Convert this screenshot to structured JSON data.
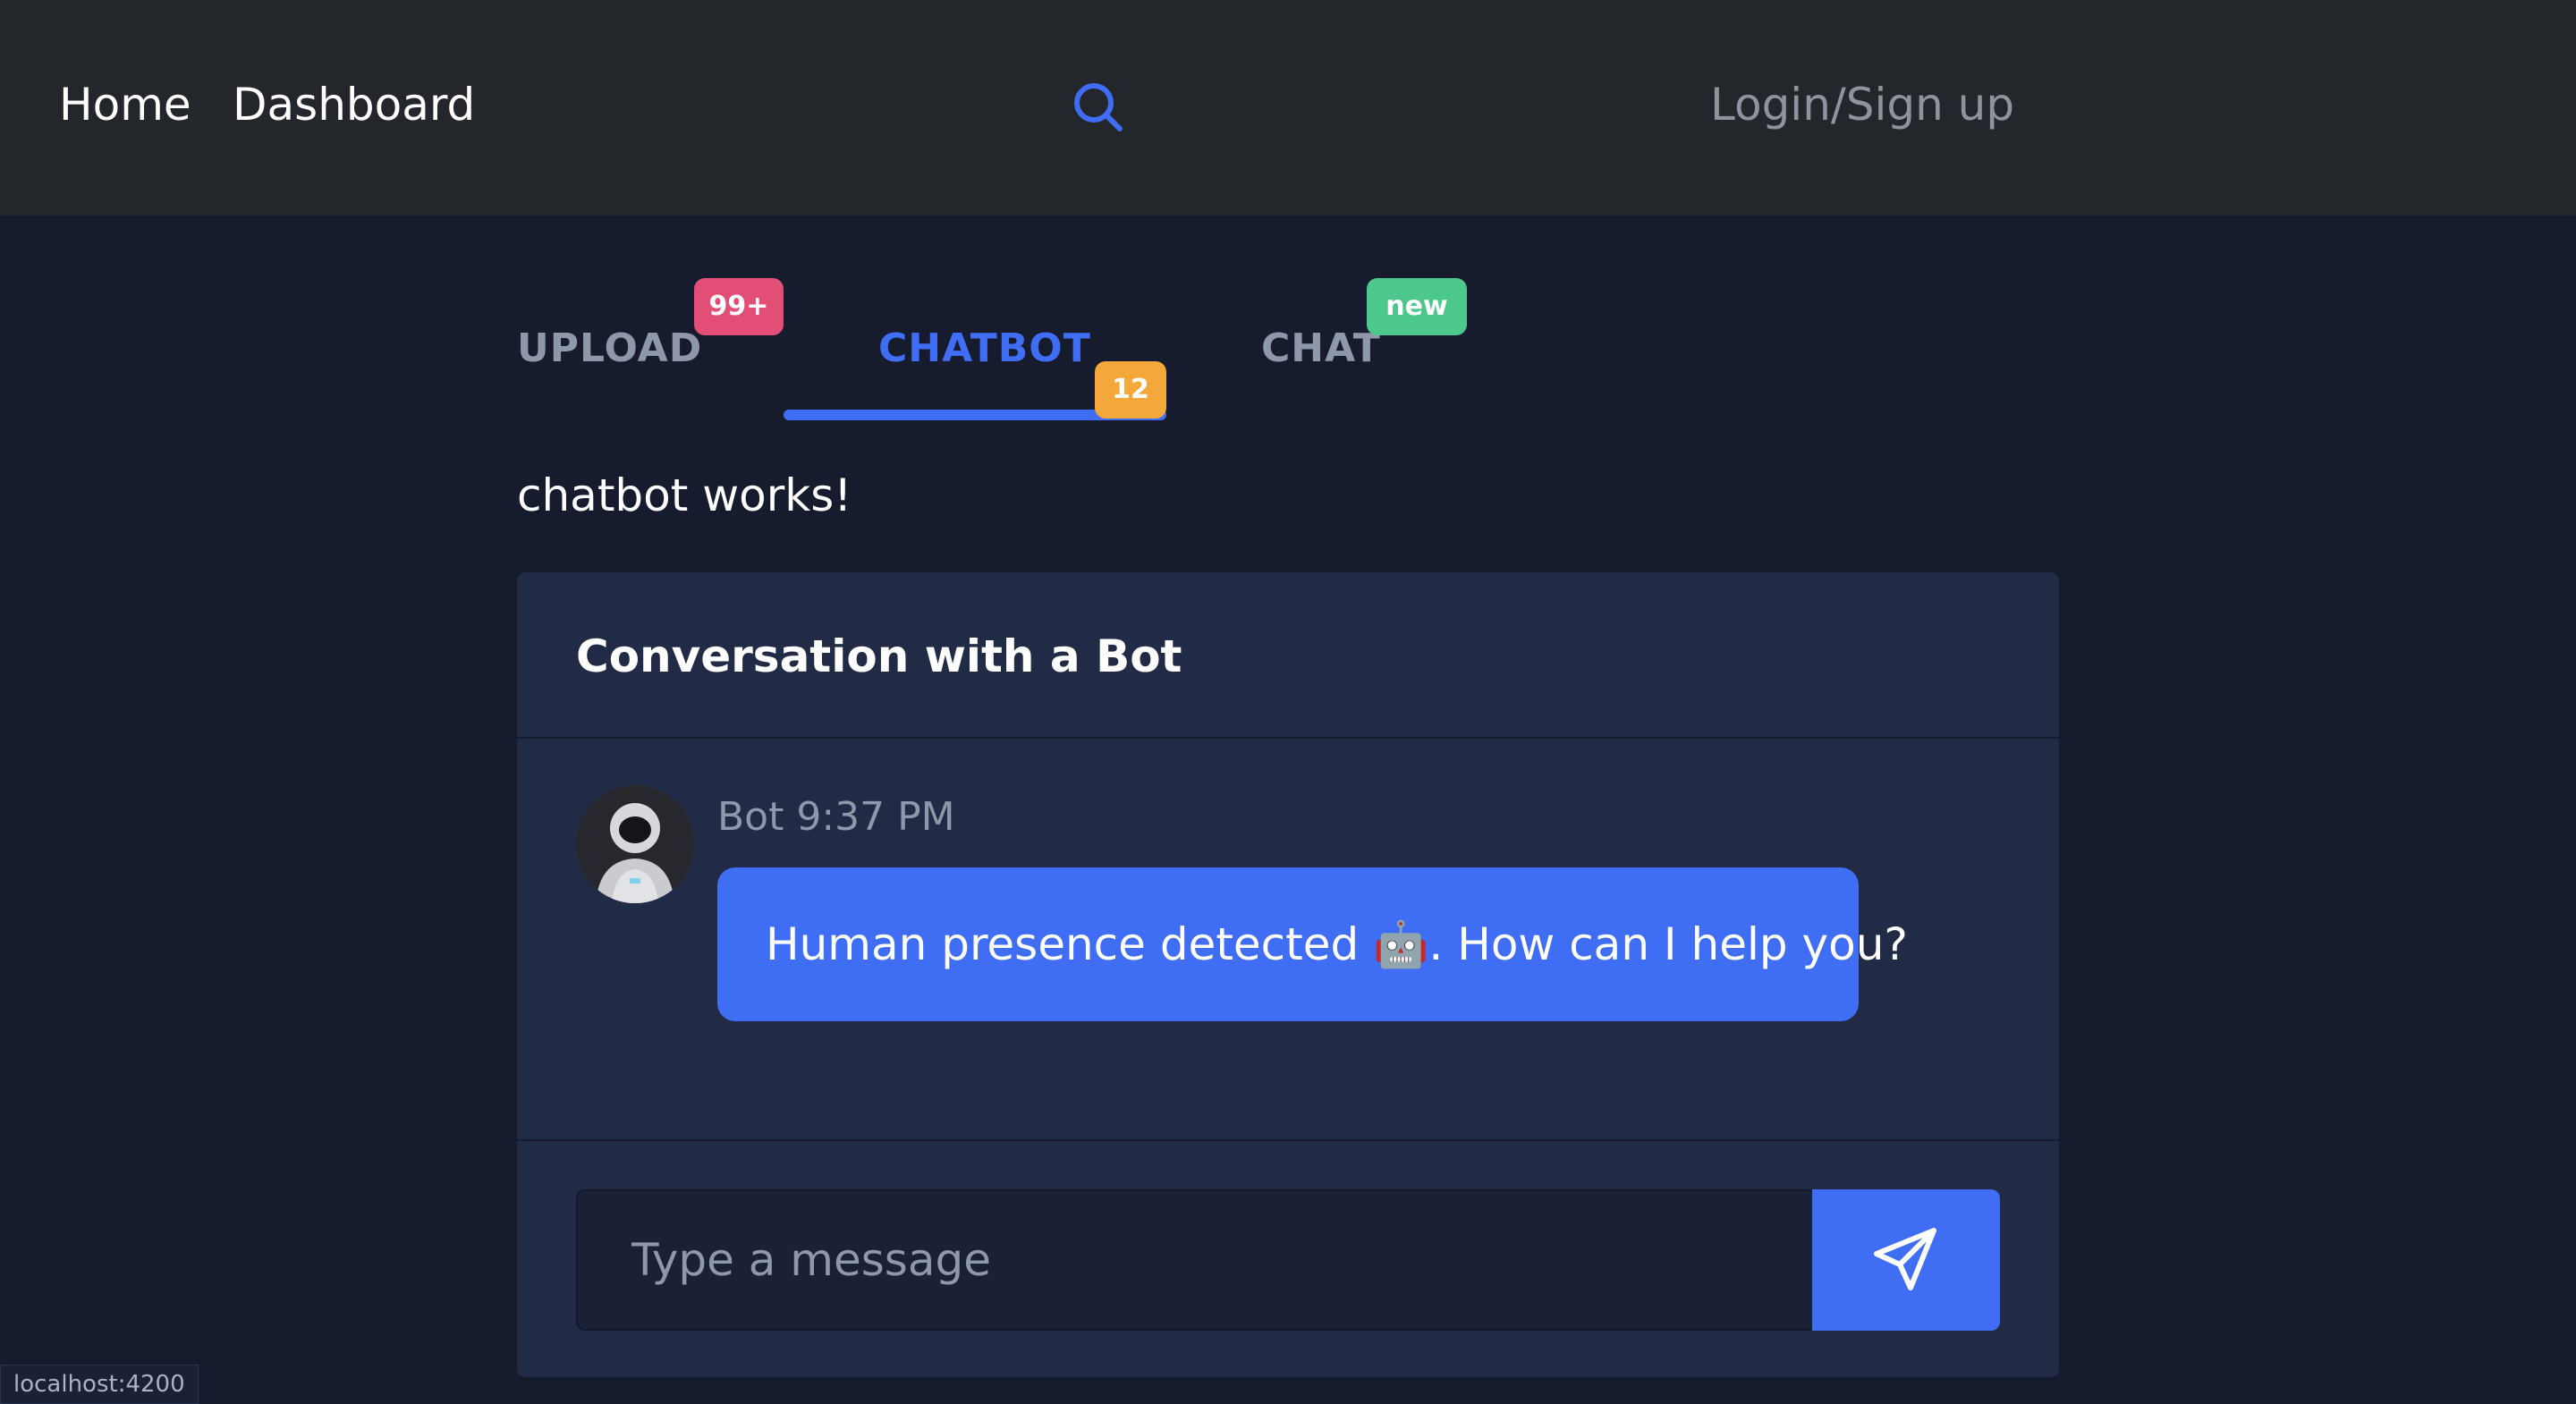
{
  "nav": {
    "home": "Home",
    "dashboard": "Dashboard",
    "search_icon": "search-icon",
    "login": "Login/Sign up"
  },
  "tabs": [
    {
      "label": "UPLOAD",
      "badge": "99+",
      "badge_color": "#e34e77",
      "active": false
    },
    {
      "label": "CHATBOT",
      "badge": "12",
      "badge_color": "#f5a83a",
      "active": true
    },
    {
      "label": "CHAT",
      "badge": "new",
      "badge_color": "#4dc88d",
      "active": false
    }
  ],
  "status_text": "chatbot works!",
  "card": {
    "title": "Conversation with a Bot",
    "messages": [
      {
        "sender": "Bot",
        "time": "9:37 PM",
        "meta": "Bot 9:37 PM",
        "text": "Human presence detected 🤖. How can I help you?",
        "avatar": "robot-avatar"
      }
    ],
    "input": {
      "placeholder": "Type a message",
      "value": ""
    },
    "send_icon": "send-icon"
  },
  "browser_status": "localhost:4200",
  "colors": {
    "accent": "#3f6ef4",
    "background": "#161b2e",
    "topbar": "#23262b",
    "card": "#222b45"
  }
}
